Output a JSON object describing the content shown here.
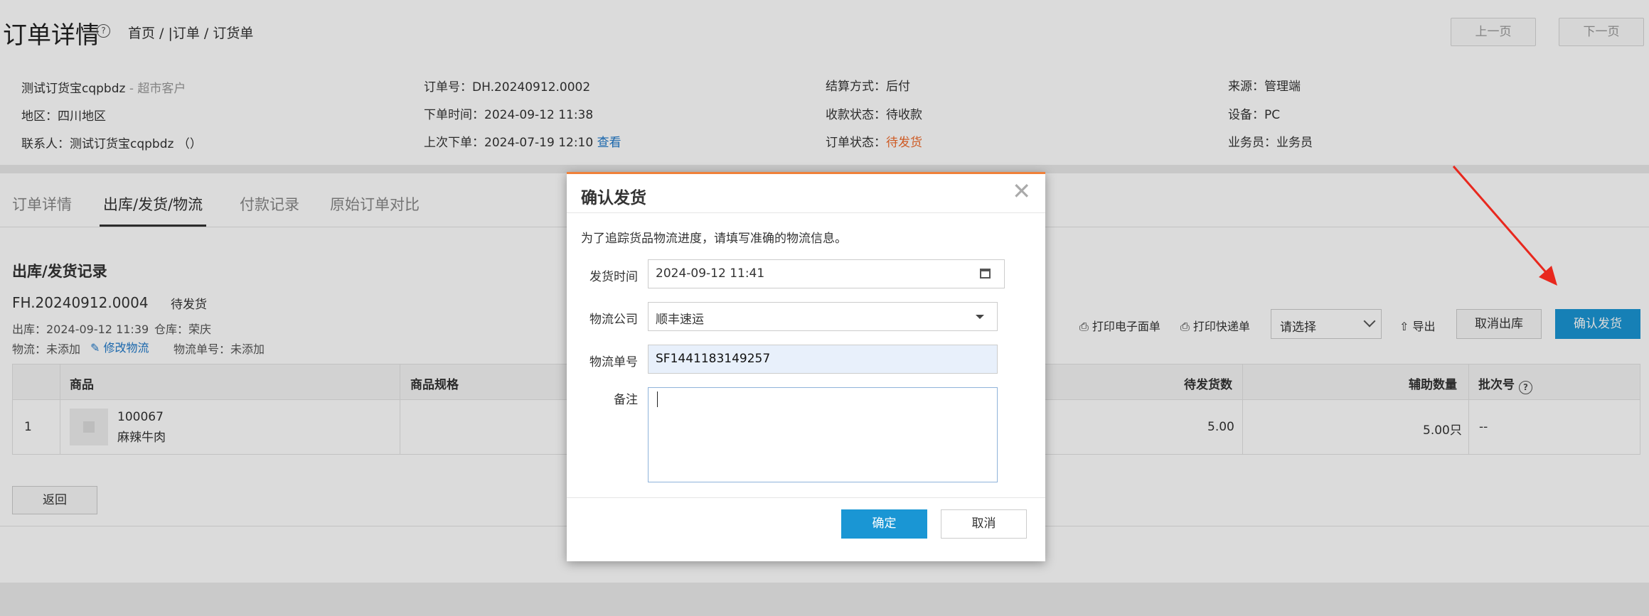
{
  "header": {
    "title": "订单详情",
    "help_icon": "?",
    "breadcrumb": "首页 / |订单 / 订货单",
    "prev_button": "上一页",
    "next_button": "下一页"
  },
  "info": {
    "col1": {
      "customer_name": "测试订货宝cqpbdz",
      "customer_type": " - 超市客户",
      "region": "地区：四川地区",
      "contact": "联系人：测试订货宝cqpbdz （）"
    },
    "col2": {
      "order_no": "订单号：DH.20240912.0002",
      "order_time": "下单时间：2024-09-12 11:38",
      "last_order": "上次下单：2024-07-19 12:10",
      "view_link": "查看"
    },
    "col3": {
      "settlement": "结算方式：后付",
      "payment_status": "收款状态：待收款",
      "order_status_label": "订单状态：",
      "order_status_value": "待发货"
    },
    "col4": {
      "source": "来源：管理端",
      "device": "设备：PC",
      "salesman": "业务员：业务员"
    }
  },
  "tabs": [
    {
      "label": "订单详情"
    },
    {
      "label": "出库/发货/物流"
    },
    {
      "label": "付款记录"
    },
    {
      "label": "原始订单对比"
    }
  ],
  "shipment": {
    "section_title": "出库/发货记录",
    "number": "FH.20240912.0004",
    "status": "待发货",
    "outbound": "出库：2024-09-12 11:39",
    "warehouse": "仓库：荣庆",
    "logistics": "物流：未添加",
    "edit_logistics": "修改物流",
    "tracking": "物流单号：未添加"
  },
  "toolbar": {
    "print_electronic": "打印电子面单",
    "print_express": "打印快递单",
    "select_placeholder": "请选择",
    "export": "导出",
    "cancel_outbound": "取消出库",
    "confirm_shipping": "确认发货"
  },
  "table": {
    "headers": [
      "商品",
      "商品规格",
      "待发货数",
      "辅助数量",
      "批次号"
    ],
    "rows": [
      {
        "index": "1",
        "code": "100067",
        "name": "麻辣牛肉",
        "pending": "5.00",
        "aux": "5.00只",
        "batch": "--"
      }
    ]
  },
  "back_button": "返回",
  "modal": {
    "title": "确认发货",
    "close": "✕",
    "hint": "为了追踪货品物流进度，请填写准确的物流信息。",
    "ship_time_label": "发货时间",
    "ship_time_value": "2024-09-12 11:41",
    "carrier_label": "物流公司",
    "carrier_value": "顺丰速运",
    "tracking_label": "物流单号",
    "tracking_value": "SF1441183149257",
    "remark_label": "备注",
    "ok_button": "确定",
    "cancel_button": "取消"
  },
  "colors": {
    "primary": "#1a96d4",
    "accent_orange": "#f06a2b",
    "modal_top_border": "#f0813a",
    "annotation_arrow": "#e8281e",
    "link": "#1f78c9"
  }
}
